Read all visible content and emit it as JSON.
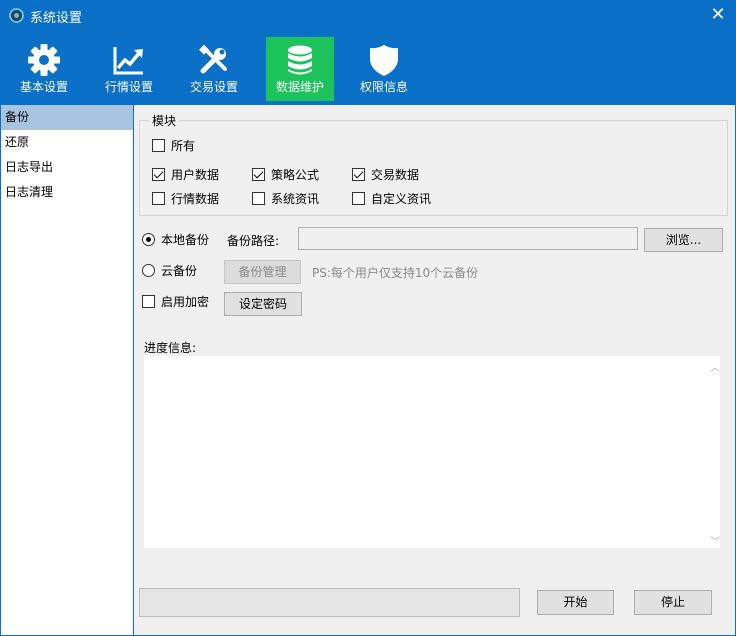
{
  "window": {
    "title": "系统设置"
  },
  "toolbar": {
    "items": [
      {
        "label": "基本设置",
        "icon": "gear-icon"
      },
      {
        "label": "行情设置",
        "icon": "trend-chart-icon"
      },
      {
        "label": "交易设置",
        "icon": "tools-icon"
      },
      {
        "label": "数据维护",
        "icon": "database-icon",
        "active": true
      },
      {
        "label": "权限信息",
        "icon": "shield-icon"
      }
    ]
  },
  "sidebar": {
    "items": [
      {
        "label": "备份",
        "active": true
      },
      {
        "label": "还原"
      },
      {
        "label": "日志导出"
      },
      {
        "label": "日志清理"
      }
    ]
  },
  "modules": {
    "legend": "模块",
    "all": {
      "label": "所有",
      "checked": false
    },
    "items": [
      {
        "label": "用户数据",
        "checked": true
      },
      {
        "label": "策略公式",
        "checked": true
      },
      {
        "label": "交易数据",
        "checked": true
      },
      {
        "label": "行情数据",
        "checked": false
      },
      {
        "label": "系统资讯",
        "checked": false
      },
      {
        "label": "自定义资讯",
        "checked": false
      }
    ]
  },
  "backup": {
    "local_label": "本地备份",
    "local_selected": true,
    "path_label": "备份路径:",
    "path_value": "",
    "browse_label": "浏览...",
    "cloud_label": "云备份",
    "cloud_selected": false,
    "manage_label": "备份管理",
    "cloud_hint": "PS:每个用户仅支持10个云备份",
    "encrypt_label": "启用加密",
    "encrypt_checked": false,
    "set_password_label": "设定密码"
  },
  "progress": {
    "label": "进度信息:",
    "text": "",
    "value": 0
  },
  "actions": {
    "start_label": "开始",
    "stop_label": "停止"
  },
  "colors": {
    "titlebar": "#0a6fc6",
    "active_tool": "#1bc35a",
    "active_nav": "#a8c4e0",
    "panel": "#f0f0f0"
  }
}
